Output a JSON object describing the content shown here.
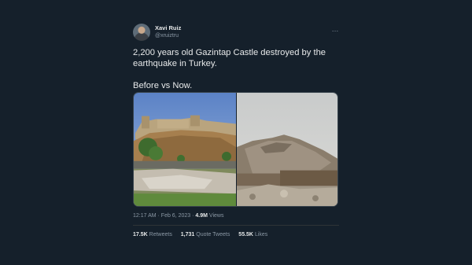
{
  "tweet": {
    "display_name": "Xavi Ruiz",
    "handle": "@xruiztru",
    "more_icon": "…",
    "text": "2,200 years old Gazintap Castle destroyed by the earthquake in Turkey.\n\nBefore vs Now.",
    "timestamp": "12:17 AM · Feb 6, 2023 · ",
    "views_count": "4.9M",
    "views_label": " Views",
    "retweets_count": "17.5K",
    "retweets_label": "Retweets",
    "quotes_count": "1,731",
    "quotes_label": "Quote Tweets",
    "likes_count": "55.5K",
    "likes_label": "Likes"
  },
  "colors": {
    "background": "#15202b",
    "text": "#e7e9ea",
    "secondary_text": "#8b98a5"
  }
}
